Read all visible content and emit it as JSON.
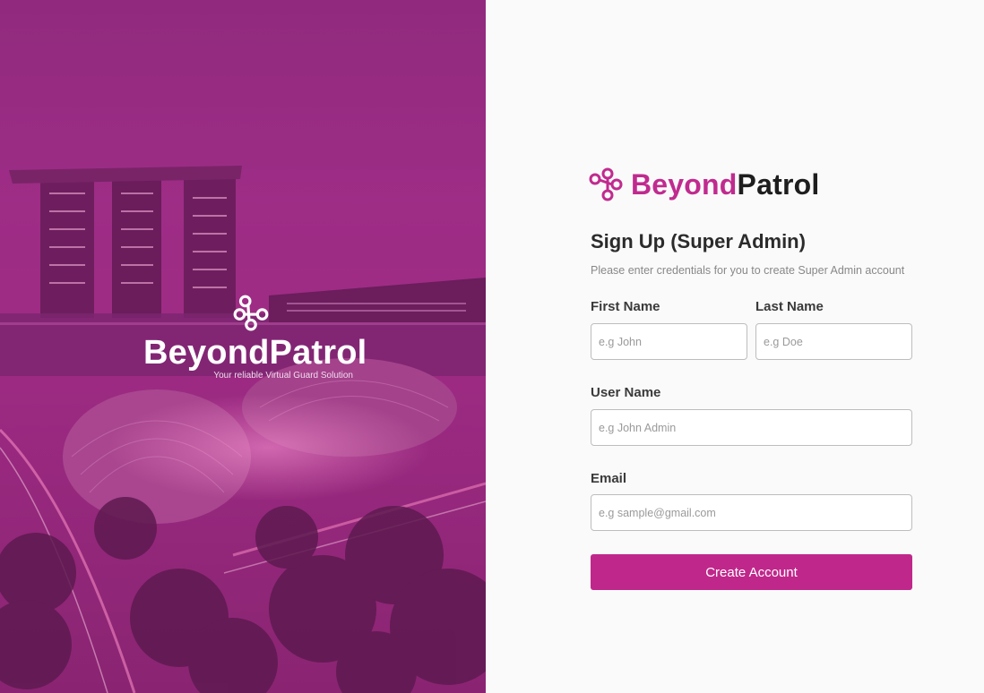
{
  "hero": {
    "brand_name": "BeyondPatrol",
    "tagline": "Your reliable Virtual Guard Solution"
  },
  "brand": {
    "beyond": "Beyond",
    "patrol": "Patrol",
    "logo_icon": "network-nodes-icon"
  },
  "form": {
    "title": "Sign Up (Super Admin)",
    "subtitle": "Please enter credentials for you to create Super Admin account",
    "first_name": {
      "label": "First Name",
      "placeholder": "e.g John",
      "value": ""
    },
    "last_name": {
      "label": "Last Name",
      "placeholder": "e.g Doe",
      "value": ""
    },
    "user_name": {
      "label": "User Name",
      "placeholder": "e.g John Admin",
      "value": ""
    },
    "email": {
      "label": "Email",
      "placeholder": "e.g sample@gmail.com",
      "value": ""
    },
    "submit_label": "Create Account"
  },
  "colors": {
    "accent": "#c0278b",
    "hero_overlay": "#9c2a82",
    "text_dark": "#1e1e1e"
  }
}
